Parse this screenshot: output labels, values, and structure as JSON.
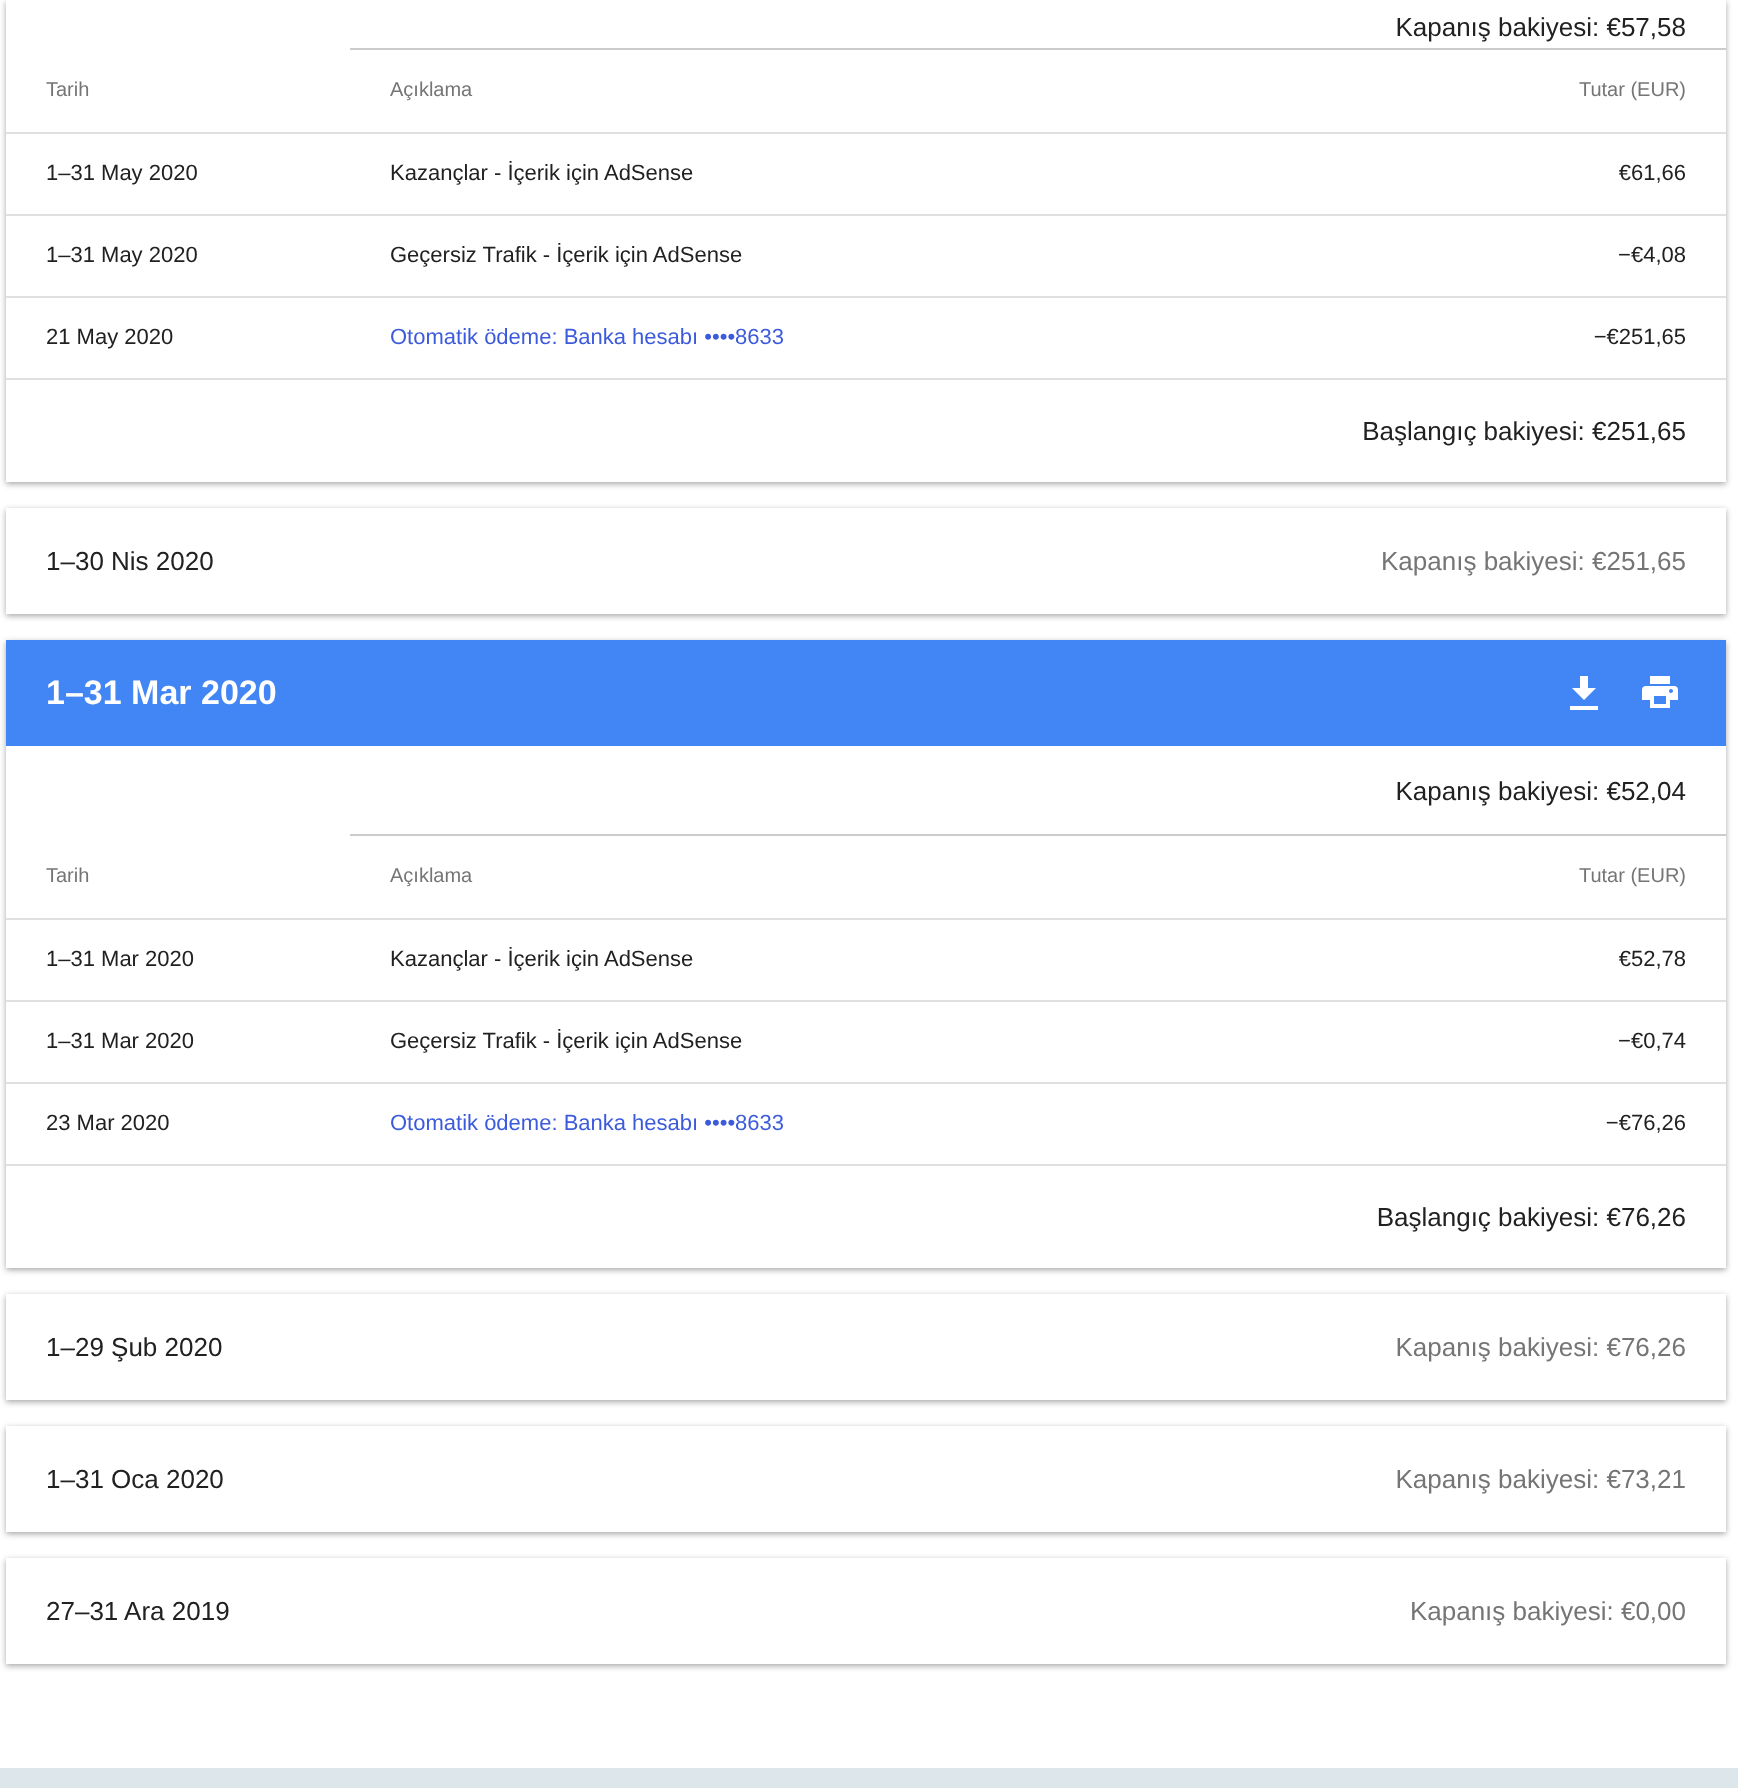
{
  "statements": [
    {
      "expanded": true,
      "closing_balance": "Kapanış bakiyesi: €57,58",
      "columns": [
        "Tarih",
        "Açıklama",
        "Tutar (EUR)"
      ],
      "rows": [
        {
          "date": "1–31 May 2020",
          "description": "Kazançlar - İçerik için AdSense",
          "amount": "€61,66",
          "kind": "text"
        },
        {
          "date": "1–31 May 2020",
          "description": "Geçersiz Trafik - İçerik için AdSense",
          "amount": "−€4,08",
          "kind": "text"
        },
        {
          "date": "21 May 2020",
          "description": "Otomatik ödeme: Banka hesabı ••••8633",
          "amount": "−€251,65",
          "kind": "link"
        }
      ],
      "opening_balance": "Başlangıç bakiyesi: €251,65"
    },
    {
      "period": "1–30 Nis 2020",
      "expanded": false,
      "closing_balance": "Kapanış bakiyesi: €251,65"
    },
    {
      "period": "1–31 Mar 2020",
      "expanded": true,
      "closing_balance": "Kapanış bakiyesi: €52,04",
      "columns": [
        "Tarih",
        "Açıklama",
        "Tutar (EUR)"
      ],
      "rows": [
        {
          "date": "1–31 Mar 2020",
          "description": "Kazançlar - İçerik için AdSense",
          "amount": "€52,78",
          "kind": "text"
        },
        {
          "date": "1–31 Mar 2020",
          "description": "Geçersiz Trafik - İçerik için AdSense",
          "amount": "−€0,74",
          "kind": "text"
        },
        {
          "date": "23 Mar 2020",
          "description": "Otomatik ödeme: Banka hesabı ••••8633",
          "amount": "−€76,26",
          "kind": "link"
        }
      ],
      "opening_balance": "Başlangıç bakiyesi: €76,26"
    },
    {
      "period": "1–29 Şub 2020",
      "expanded": false,
      "closing_balance": "Kapanış bakiyesi: €76,26"
    },
    {
      "period": "1–31 Oca 2020",
      "expanded": false,
      "closing_balance": "Kapanış bakiyesi: €73,21"
    },
    {
      "period": "27–31 Ara 2019",
      "expanded": false,
      "closing_balance": "Kapanış bakiyesi: €0,00"
    }
  ]
}
